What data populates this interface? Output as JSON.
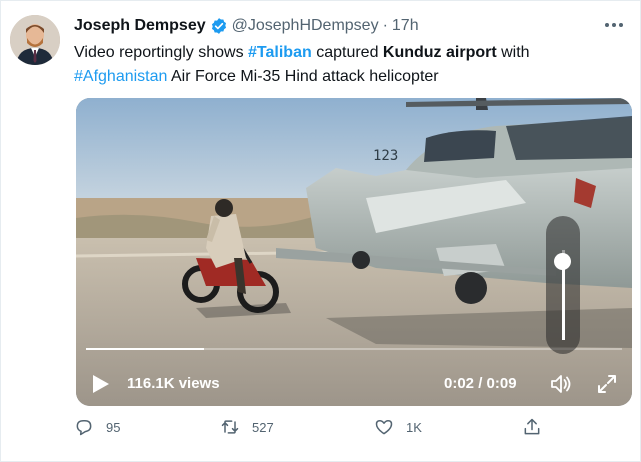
{
  "tweet": {
    "author": {
      "display_name": "Joseph Dempsey",
      "handle": "@JosephHDempsey",
      "separator": "·",
      "time": "17h",
      "verified": true,
      "avatar_icon": "avatar-photo"
    },
    "text": {
      "part1": "Video reportingly shows ",
      "hashtag_taliban": "#Taliban",
      "part2": " captured ",
      "bold_kunduz": "Kunduz airport",
      "part3": " with",
      "hashtag_afghanistan": "#Afghanistan",
      "part4": " Air Force Mi-35 Hind attack helicopter"
    },
    "video": {
      "views": "116.1K views",
      "timecode": "0:02 / 0:09",
      "progress": 0.22,
      "volume_level": 0.88,
      "helicopter_tail_marking": "123",
      "icons": [
        "play-icon",
        "volume-icon",
        "fullscreen-icon"
      ]
    },
    "actions": {
      "reply_count": "95",
      "retweet_count": "527",
      "like_count": "1K",
      "icons": [
        "reply-icon",
        "retweet-icon",
        "like-icon",
        "share-icon"
      ]
    },
    "colors": {
      "link": "#1d9bf0",
      "verified": "#1d9bf0",
      "muted_text": "#536471"
    }
  }
}
